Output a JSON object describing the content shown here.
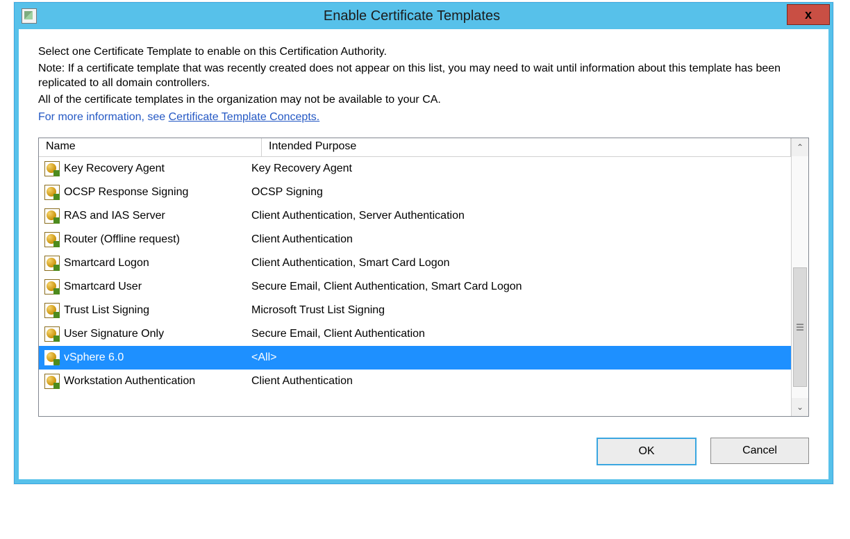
{
  "window": {
    "title": "Enable Certificate Templates",
    "close_glyph": "x"
  },
  "intro": {
    "line1": "Select one Certificate Template to enable on this Certification Authority.",
    "line2": "Note: If a certificate template that was recently created does not appear on this list, you may need to wait until information about this template has been replicated to all domain controllers.",
    "line3": "All of the certificate templates in the organization may not be available to your CA.",
    "info_prefix": "For more information, see ",
    "info_link": "Certificate Template Concepts."
  },
  "columns": {
    "name": "Name",
    "purpose": "Intended Purpose"
  },
  "rows": [
    {
      "name": "Key Recovery Agent",
      "purpose": "Key Recovery Agent",
      "selected": false
    },
    {
      "name": "OCSP Response Signing",
      "purpose": "OCSP Signing",
      "selected": false
    },
    {
      "name": "RAS and IAS Server",
      "purpose": "Client Authentication, Server Authentication",
      "selected": false
    },
    {
      "name": "Router (Offline request)",
      "purpose": "Client Authentication",
      "selected": false
    },
    {
      "name": "Smartcard Logon",
      "purpose": "Client Authentication, Smart Card Logon",
      "selected": false
    },
    {
      "name": "Smartcard User",
      "purpose": "Secure Email, Client Authentication, Smart Card Logon",
      "selected": false
    },
    {
      "name": "Trust List Signing",
      "purpose": "Microsoft Trust List Signing",
      "selected": false
    },
    {
      "name": "User Signature Only",
      "purpose": "Secure Email, Client Authentication",
      "selected": false
    },
    {
      "name": "vSphere 6.0",
      "purpose": "<All>",
      "selected": true
    },
    {
      "name": "Workstation Authentication",
      "purpose": "Client Authentication",
      "selected": false
    }
  ],
  "scroll": {
    "up": "⌃",
    "down": "⌄",
    "thumb": "≡"
  },
  "buttons": {
    "ok": "OK",
    "cancel": "Cancel"
  }
}
